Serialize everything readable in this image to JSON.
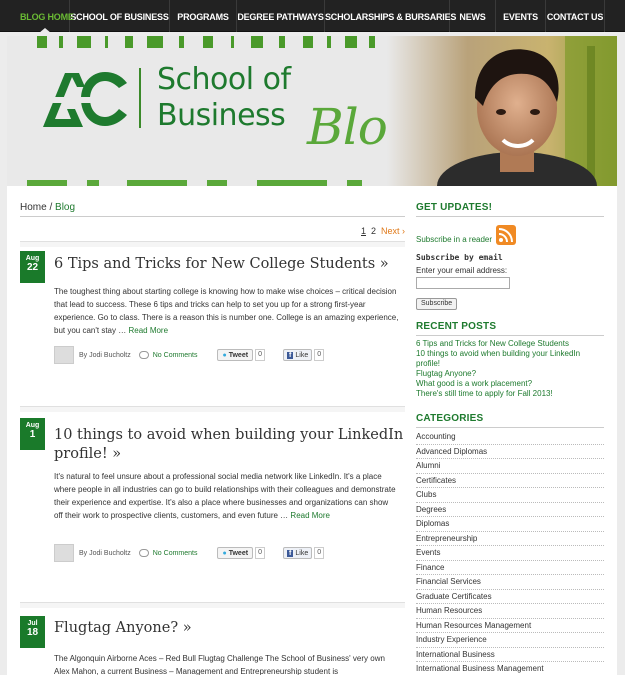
{
  "nav": {
    "items": [
      "BLOG HOME",
      "SCHOOL OF BUSINESS",
      "PROGRAMS",
      "DEGREE PATHWAYS",
      "SCHOLARSHIPS & BURSARIES",
      "NEWS",
      "EVENTS",
      "CONTACT US"
    ],
    "active": "BLOG HOME"
  },
  "banner": {
    "logo": "AC",
    "title_line1": "School of",
    "title_line2": "Business",
    "script": "Blog"
  },
  "breadcrumb": {
    "home": "Home",
    "separator": "/",
    "current": "Blog"
  },
  "pagination": {
    "pages": [
      "1",
      "2"
    ],
    "current": "1",
    "next": "Next ›"
  },
  "posts": [
    {
      "month": "Aug",
      "day": "22",
      "title": "6 Tips and Tricks for New College Students »",
      "body": "The toughest thing about starting college is knowing how to make wise choices – critical decision that lead to success. These 6 tips and tricks can help to set you up for a strong first-year experience. Go to class. There is a reason this is number one. College is an amazing experience, but you can't stay …",
      "read_more": "Read More",
      "author": "By Jodi Bucholtz",
      "comments": "No Comments",
      "tweet": "Tweet",
      "tweet_count": "0",
      "like": "Like",
      "like_count": "0"
    },
    {
      "month": "Aug",
      "day": "1",
      "title": "10 things to avoid when building your LinkedIn profile! »",
      "body": "It's natural to feel unsure about a professional social media network like LinkedIn. It's a place where people in all industries can go to build relationships with their colleagues and demonstrate their experience and expertise. It's also a place where businesses and organizations can show off their work to prospective clients, customers, and even future …",
      "read_more": "Read More",
      "author": "By Jodi Bucholtz",
      "comments": "No Comments",
      "tweet": "Tweet",
      "tweet_count": "0",
      "like": "Like",
      "like_count": "0"
    },
    {
      "month": "Jul",
      "day": "18",
      "title": "Flugtag Anyone? »",
      "body": "The Algonquin Airborne Aces – Red Bull Flugtag Challenge The School of Business' very own Alex Mahon, a current Business – Management and Entrepreneurship student is"
    }
  ],
  "sidebar": {
    "updates": {
      "heading": "GET UPDATES!",
      "reader_link": "Subscribe in a reader",
      "email_heading": "Subscribe by email",
      "email_label": "Enter your email address:",
      "email_value": "",
      "subscribe_button": "Subscribe"
    },
    "recent": {
      "heading": "RECENT POSTS",
      "items": [
        "6 Tips and Tricks for New College Students",
        "10 things to avoid when building your LinkedIn profile!",
        "Flugtag Anyone?",
        "What good is a work placement?",
        "There's still time to apply for Fall 2013!"
      ]
    },
    "categories": {
      "heading": "CATEGORIES",
      "items": [
        "Accounting",
        "Advanced Diplomas",
        "Alumni",
        "Certificates",
        "Clubs",
        "Degrees",
        "Diplomas",
        "Entrepreneurship",
        "Events",
        "Finance",
        "Financial Services",
        "Graduate Certificates",
        "Human Resources",
        "Human Resources Management",
        "Industry Experience",
        "International Business",
        "International Business Management"
      ]
    }
  },
  "colors": {
    "brand_green": "#1e7a2e",
    "light_green": "#5aa83a",
    "nav_bg": "#222222",
    "nav_active": "#6aba34",
    "next_link": "#e07a1a"
  }
}
